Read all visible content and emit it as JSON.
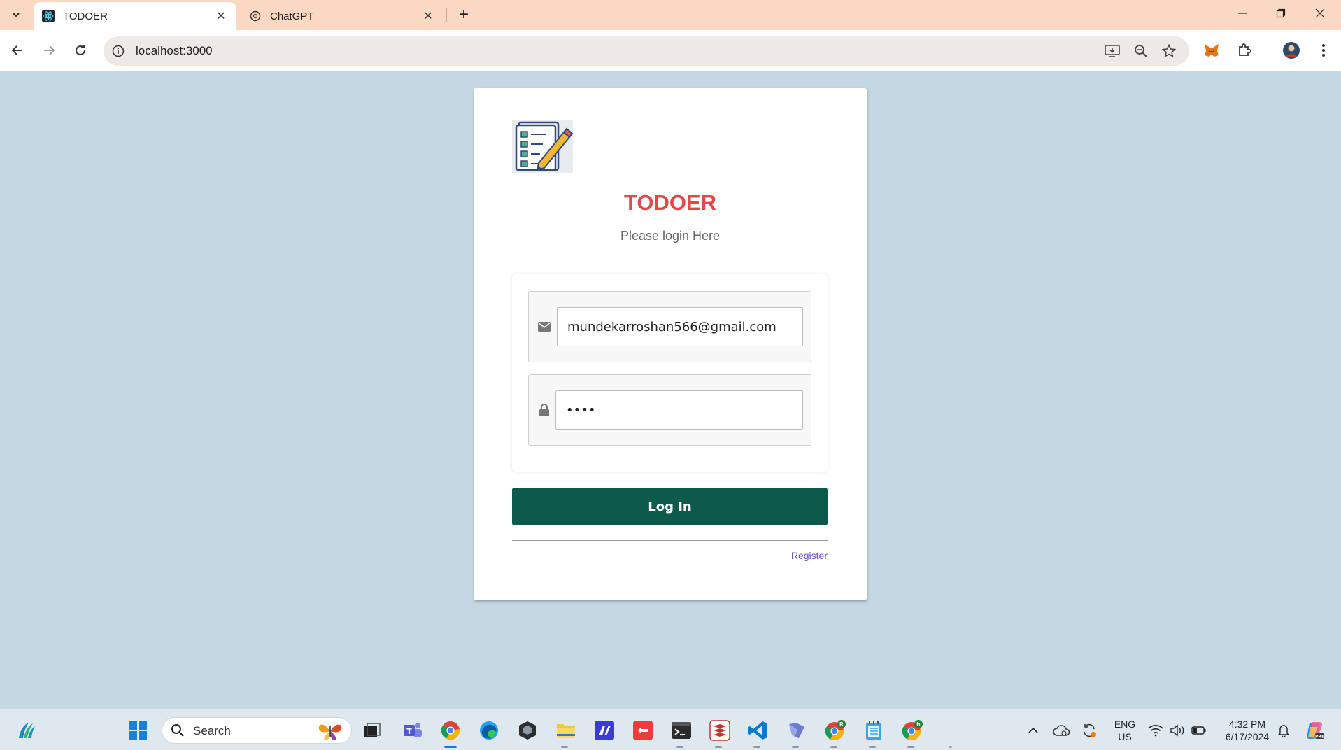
{
  "browser": {
    "tabs": [
      {
        "title": "TODOER",
        "active": true
      },
      {
        "title": "ChatGPT",
        "active": false
      }
    ],
    "url": "localhost:3000"
  },
  "page": {
    "app_title": "TODOER",
    "subtitle": "Please login Here",
    "email_value": "mundekarroshan566@gmail.com",
    "password_value": "••••",
    "login_label": "Log In",
    "register_label": "Register"
  },
  "taskbar": {
    "search_label": "Search",
    "language_line1": "ENG",
    "language_line2": "US",
    "time": "4:32 PM",
    "date": "6/17/2024"
  },
  "colors": {
    "page_bg": "#c4d7e2",
    "title_red": "#e0484a",
    "login_button": "#0d5a4d",
    "register_link": "#5b53c9",
    "tabbar": "#fbd8c3"
  }
}
